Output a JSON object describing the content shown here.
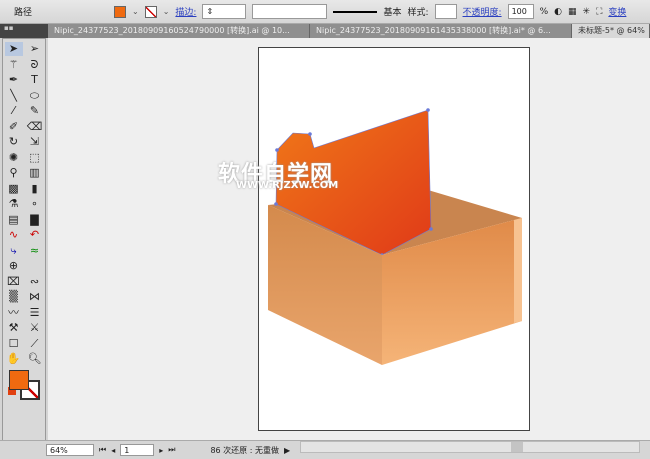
{
  "control_bar": {
    "object_type": "路径",
    "stroke_label": "描边:",
    "brush_label": "基本",
    "style_label": "样式:",
    "opacity_label": "不透明度:",
    "opacity_value": "100",
    "opacity_unit": "%",
    "transform_label": "变换",
    "fill_color": "#f06a10"
  },
  "tabs": [
    {
      "label": "Nipic_24377523_20180909160524790000 [转换].ai @ 10...",
      "active": false
    },
    {
      "label": "Nipic_24377523_20180909161435338000 [转换].ai* @ 6...",
      "active": false
    },
    {
      "label": "未标题-5* @ 64%",
      "active": true
    }
  ],
  "watermark": {
    "title": "软件自学网",
    "url": "WWW.RJZXW.COM"
  },
  "status_bar": {
    "zoom": "64%",
    "artboard": "1",
    "history": "86 次还原 : 无重做"
  },
  "colors": {
    "accent": "#f06a10",
    "box_light": "#f2a868",
    "box_dark": "#d97e3c"
  }
}
